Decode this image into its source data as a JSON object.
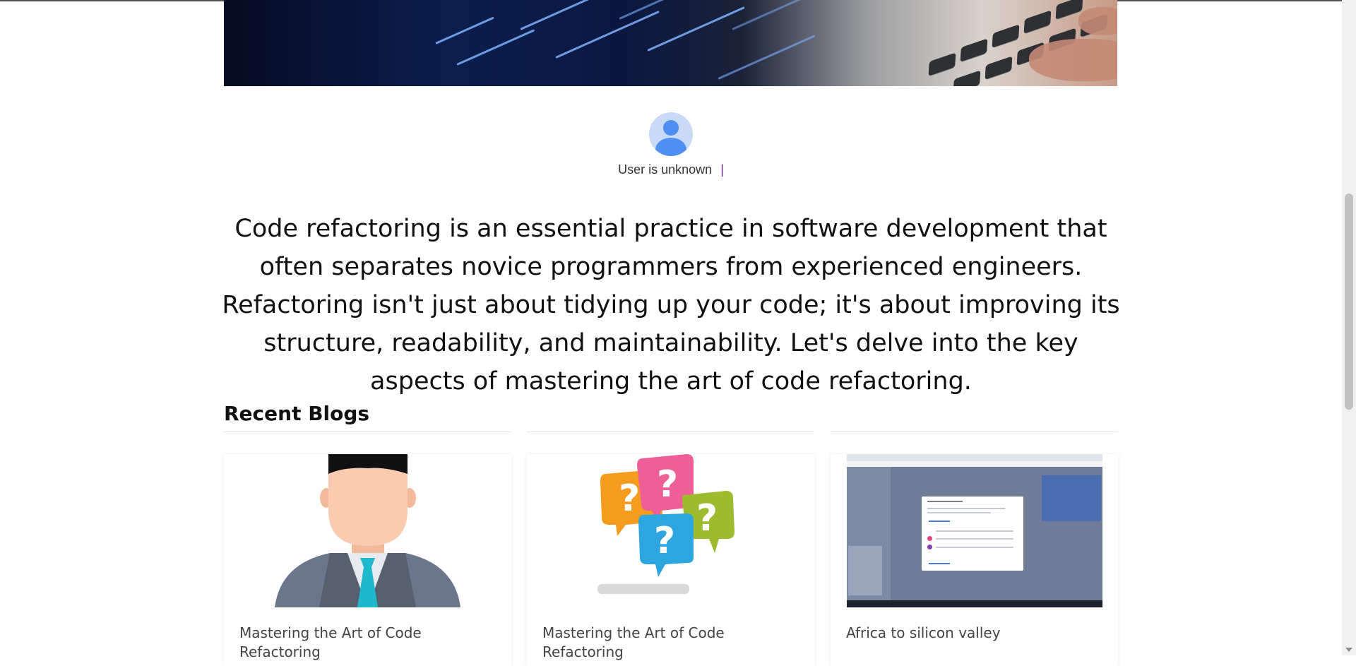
{
  "author": {
    "name": "User is unknown",
    "separator": "|"
  },
  "intro": "Code refactoring is an essential practice in software development that often separates novice programmers from experienced engineers. Refactoring isn't just about tidying up your code; it's about improving its structure, readability, and maintainability. Let's delve into the key aspects of mastering the art of code refactoring.",
  "recent": {
    "title": "Recent Blogs",
    "cards": [
      {
        "title": "Mastering the Art of Code Refactoring",
        "image": "businessman-avatar"
      },
      {
        "title": "Mastering the Art of Code Refactoring",
        "image": "question-bubbles"
      },
      {
        "title": "Africa to silicon valley",
        "image": "screenshot-thumbnail"
      }
    ]
  },
  "colors": {
    "avatar_bg": "#c9daf6",
    "avatar_fg": "#4d8ff2",
    "separator": "#6a2a8a"
  }
}
